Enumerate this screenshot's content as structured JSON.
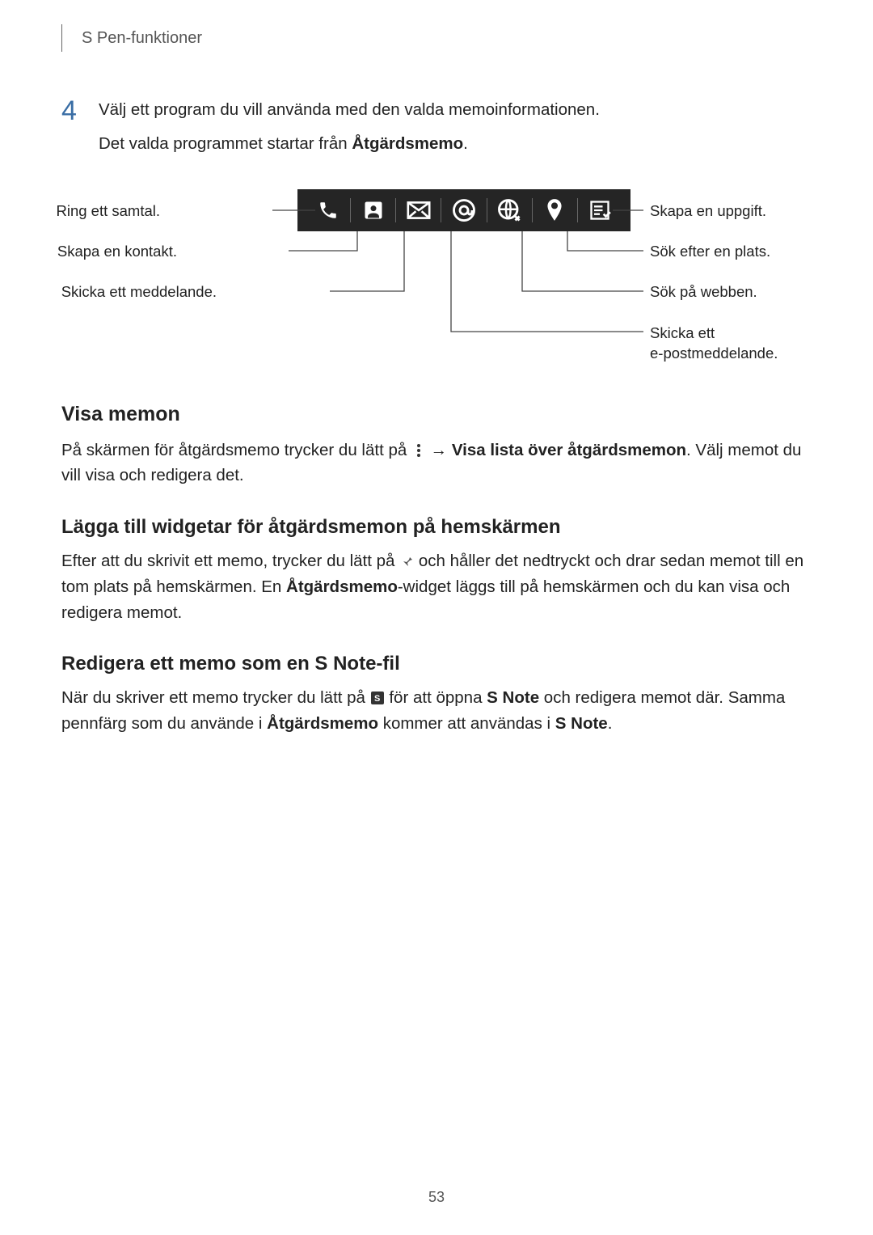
{
  "header": {
    "breadcrumb": "S Pen-funktioner"
  },
  "step": {
    "number": "4",
    "line1": "Välj ett program du vill använda med den valda memoinformationen.",
    "line2_a": "Det valda programmet startar från ",
    "line2_bold": "Åtgärdsmemo",
    "line2_b": "."
  },
  "callouts": {
    "left": {
      "call": "Ring ett samtal.",
      "contact": "Skapa en kontakt.",
      "message": "Skicka ett meddelande."
    },
    "right": {
      "task": "Skapa en uppgift.",
      "place": "Sök efter en plats.",
      "web": "Sök på webben.",
      "email_l1": "Skicka ett",
      "email_l2": "e-postmeddelande."
    }
  },
  "sections": {
    "visa": {
      "title": "Visa memon",
      "p1_a": "På skärmen för åtgärdsmemo trycker du lätt på ",
      "p1_arrow": " → ",
      "p1_bold": "Visa lista över åtgärdsmemon",
      "p1_b": ". Välj memot du vill visa och redigera det."
    },
    "widget": {
      "title": "Lägga till widgetar för åtgärdsmemon på hemskärmen",
      "p1_a": "Efter att du skrivit ett memo, trycker du lätt på ",
      "p1_b": " och håller det nedtryckt och drar sedan memot till en tom plats på hemskärmen. En ",
      "p1_bold": "Åtgärdsmemo",
      "p1_c": "-widget läggs till på hemskärmen och du kan visa och redigera memot."
    },
    "snote": {
      "title": "Redigera ett memo som en S Note-fil",
      "p1_a": "När du skriver ett memo trycker du lätt på ",
      "p1_b": " för att öppna ",
      "p1_bold1": "S Note",
      "p1_c": " och redigera memot där. Samma pennfärg som du använde i ",
      "p1_bold2": "Åtgärdsmemo",
      "p1_d": " kommer att användas i ",
      "p1_bold3": "S Note",
      "p1_e": "."
    }
  },
  "page_number": "53"
}
